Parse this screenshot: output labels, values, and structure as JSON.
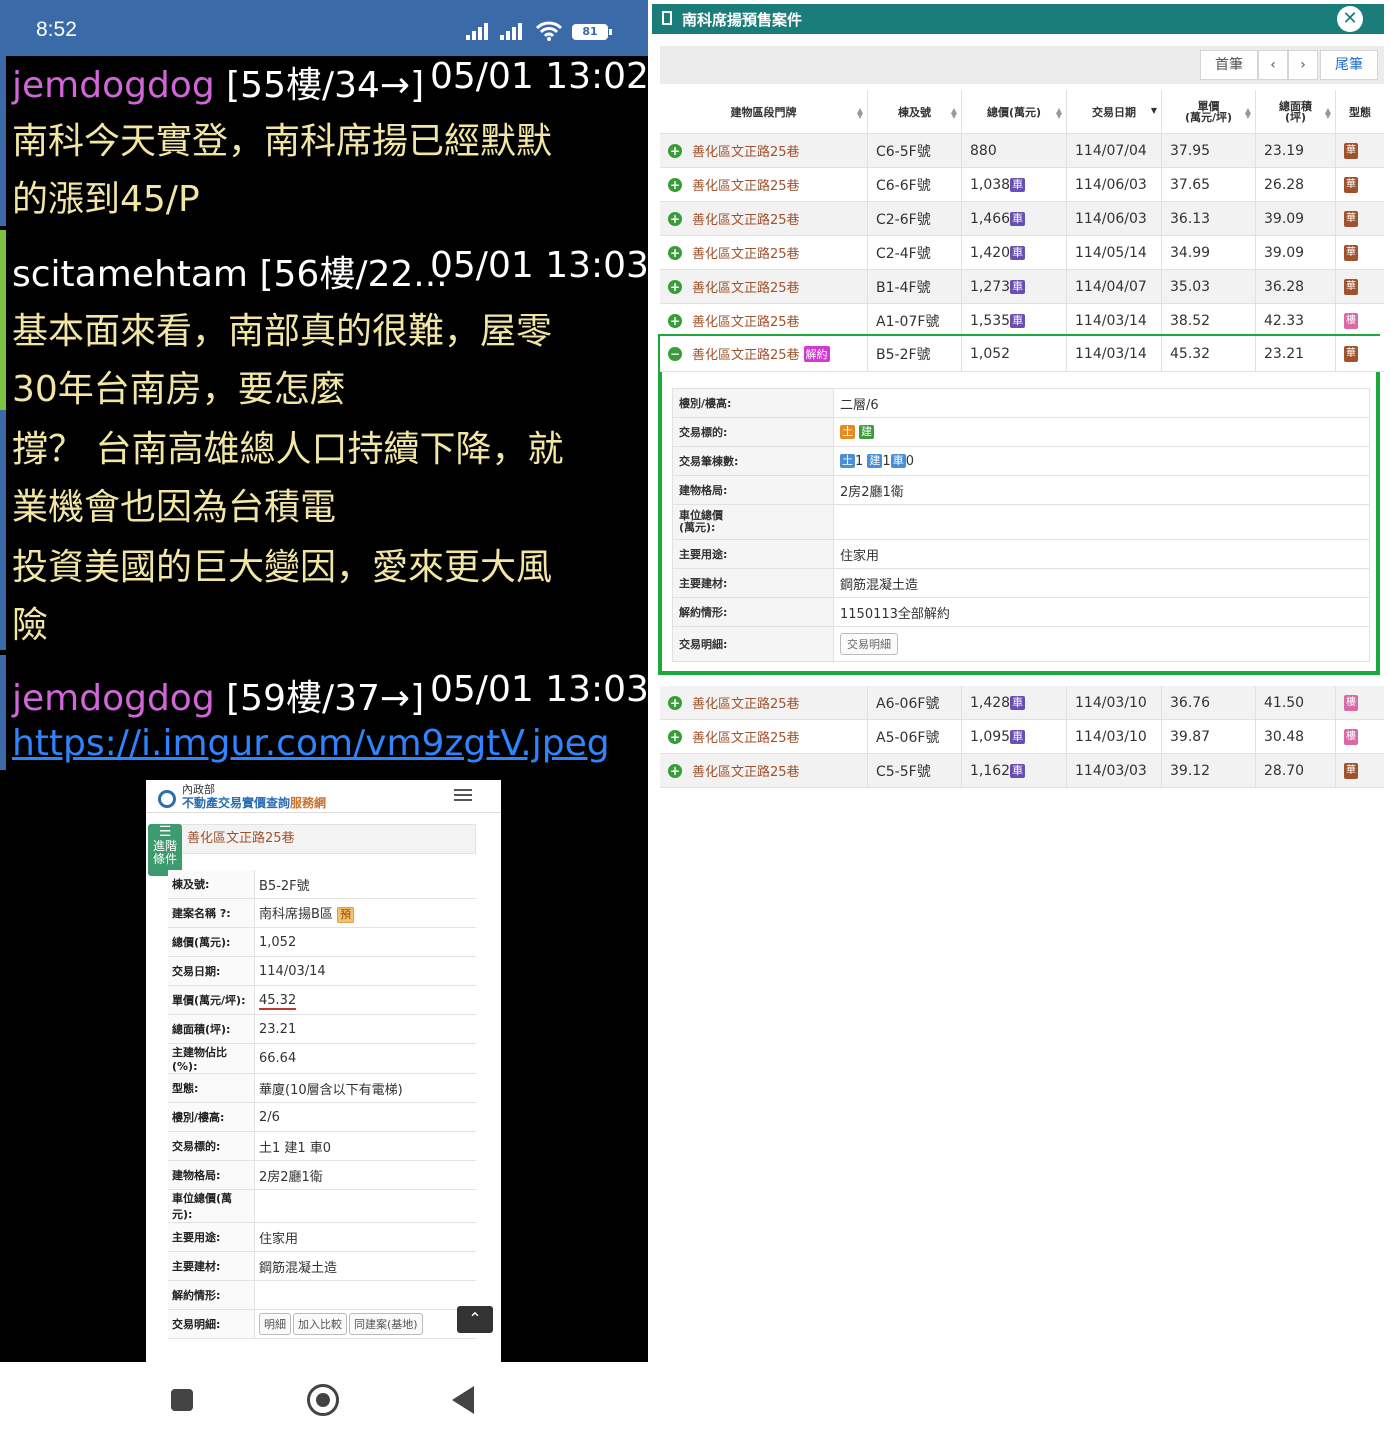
{
  "status": {
    "time": "8:52",
    "battery": "81"
  },
  "ptt": [
    {
      "author": "jemdogdog",
      "floor": "[55樓/34→]",
      "time": "05/01 13:02",
      "lines": [
        "南科今天實登，南科席揚已經默默",
        "的漲到45/P"
      ]
    },
    {
      "author": "scitamehtam",
      "floor": "[56樓/22...",
      "time": "05/01 13:03",
      "lines": [
        "基本面來看，南部真的很難，屋零",
        "30年台南房，要怎麼",
        "撐？ 台南高雄總人口持續下降，就",
        "業機會也因為台積電",
        "投資美國的巨大變因，愛來更大風",
        "險"
      ]
    },
    {
      "author": "jemdogdog",
      "floor": "[59樓/37→]",
      "time": "05/01 13:03",
      "link": "https://i.imgur.com/vm9zgtV.jpeg"
    }
  ],
  "mobile": {
    "logo_sub": "內政部",
    "logo_main": "不動產交易實價查詢",
    "logo_accent": "服務網",
    "adv_filter": [
      "進階",
      "條件"
    ],
    "title": "善化區文正路25巷",
    "rows": [
      {
        "k": "棟及號:",
        "v": "B5-2F號"
      },
      {
        "k": "建案名稱 ?:",
        "v": "南科席揚B區"
      },
      {
        "k": "總價(萬元):",
        "v": "1,052"
      },
      {
        "k": "交易日期:",
        "v": "114/03/14"
      },
      {
        "k": "單價(萬元/坪):",
        "v": "45.32"
      },
      {
        "k": "總面積(坪):",
        "v": "23.21"
      },
      {
        "k": "主建物佔比(%):",
        "v": "66.64"
      },
      {
        "k": "型態:",
        "v": "華廈(10層含以下有電梯)"
      },
      {
        "k": "樓別/樓高:",
        "v": "2/6"
      },
      {
        "k": "交易標的:",
        "v": "土1 建1 車0"
      },
      {
        "k": "建物格局:",
        "v": "2房2廳1衛"
      },
      {
        "k": "車位總價(萬元):",
        "v": ""
      },
      {
        "k": "主要用途:",
        "v": "住家用"
      },
      {
        "k": "主要建材:",
        "v": "鋼筋混凝土造"
      },
      {
        "k": "解約情形:",
        "v": ""
      },
      {
        "k": "交易明細:",
        "v": ""
      }
    ],
    "presale_tag": "預",
    "buttons": [
      "明細",
      "加入比較",
      "同建案(基地)"
    ]
  },
  "panel": {
    "title": "南科席揚預售案件",
    "pager": {
      "first": "首筆",
      "prev": "‹",
      "next": "›",
      "last": "尾筆"
    },
    "headers": [
      "建物區段門牌",
      "棟及號",
      "總價(萬元)",
      "交易日期",
      "單價\n(萬元/坪)",
      "總面積\n(坪)",
      "型態"
    ],
    "rows": [
      {
        "addr": "善化區文正路25巷",
        "unit": "C6-5F號",
        "price": "880",
        "car": false,
        "date": "114/07/04",
        "up": "37.95",
        "area": "23.19",
        "type": "華"
      },
      {
        "addr": "善化區文正路25巷",
        "unit": "C6-6F號",
        "price": "1,038",
        "car": true,
        "date": "114/06/03",
        "up": "37.65",
        "area": "26.28",
        "type": "華"
      },
      {
        "addr": "善化區文正路25巷",
        "unit": "C2-6F號",
        "price": "1,466",
        "car": true,
        "date": "114/06/03",
        "up": "36.13",
        "area": "39.09",
        "type": "華"
      },
      {
        "addr": "善化區文正路25巷",
        "unit": "C2-4F號",
        "price": "1,420",
        "car": true,
        "date": "114/05/14",
        "up": "34.99",
        "area": "39.09",
        "type": "華"
      },
      {
        "addr": "善化區文正路25巷",
        "unit": "B1-4F號",
        "price": "1,273",
        "car": true,
        "date": "114/04/07",
        "up": "35.03",
        "area": "36.28",
        "type": "華"
      },
      {
        "addr": "善化區文正路25巷",
        "unit": "A1-07F號",
        "price": "1,535",
        "car": true,
        "date": "114/03/14",
        "up": "38.52",
        "area": "42.33",
        "type": "樓"
      }
    ],
    "expanded": {
      "addr": "善化區文正路25巷",
      "cancel": "解約",
      "unit": "B5-2F號",
      "price": "1,052",
      "date": "114/03/14",
      "up": "45.32",
      "area": "23.21",
      "type": "華"
    },
    "detail": [
      {
        "k": "樓別/樓高:",
        "v": "二層/6"
      },
      {
        "k": "交易標的:",
        "v": ""
      },
      {
        "k": "交易筆棟數:",
        "v": ""
      },
      {
        "k": "建物格局:",
        "v": "2房2廳1衛"
      },
      {
        "k": "車位總價\n(萬元):",
        "v": ""
      },
      {
        "k": "主要用途:",
        "v": "住家用"
      },
      {
        "k": "主要建材:",
        "v": "鋼筋混凝土造"
      },
      {
        "k": "解約情形:",
        "v": "1150113全部解約"
      },
      {
        "k": "交易明細:",
        "v": ""
      }
    ],
    "detail_button": "交易明細",
    "tags": {
      "land": "土",
      "building": "建",
      "car": "車",
      "land_n": "1",
      "building_n": "1",
      "car_n": "0"
    },
    "rows_after": [
      {
        "addr": "善化區文正路25巷",
        "unit": "A6-06F號",
        "price": "1,428",
        "car": true,
        "date": "114/03/10",
        "up": "36.76",
        "area": "41.50",
        "type": "樓"
      },
      {
        "addr": "善化區文正路25巷",
        "unit": "A5-06F號",
        "price": "1,095",
        "car": true,
        "date": "114/03/10",
        "up": "39.87",
        "area": "30.48",
        "type": "樓"
      },
      {
        "addr": "善化區文正路25巷",
        "unit": "C5-5F號",
        "price": "1,162",
        "car": true,
        "date": "114/03/03",
        "up": "39.12",
        "area": "28.70",
        "type": "華"
      }
    ]
  }
}
